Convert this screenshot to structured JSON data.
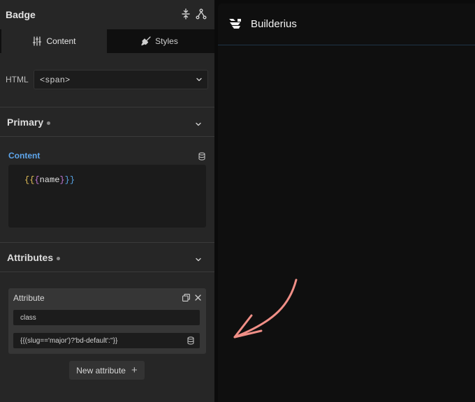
{
  "panel": {
    "title": "Badge",
    "tabs": [
      {
        "label": "Content",
        "icon": "sliders-icon",
        "active": true
      },
      {
        "label": "Styles",
        "icon": "brush-icon",
        "active": false
      }
    ],
    "html_field": {
      "label": "HTML",
      "value": "<span>"
    },
    "sections": {
      "primary": {
        "title": "Primary",
        "expanded": true
      },
      "attributes": {
        "title": "Attributes",
        "expanded": true
      }
    },
    "content_field": {
      "label": "Content",
      "code_open": "{{",
      "code_inner": "{",
      "code_var": "name",
      "code_close_inner": "}",
      "code_close": "}}"
    },
    "attribute": {
      "title": "Attribute",
      "name_value": "class",
      "value_value": "{{(slug=='major')?'bd-default':''}}"
    },
    "new_attribute_label": "New attribute"
  },
  "canvas": {
    "brand_name": "Builderius"
  },
  "colors": {
    "accent_blue": "#5ea6ec",
    "annotation_arrow": "#f08f87",
    "panel_bg": "#262626",
    "canvas_bg": "#0f0f0f"
  }
}
